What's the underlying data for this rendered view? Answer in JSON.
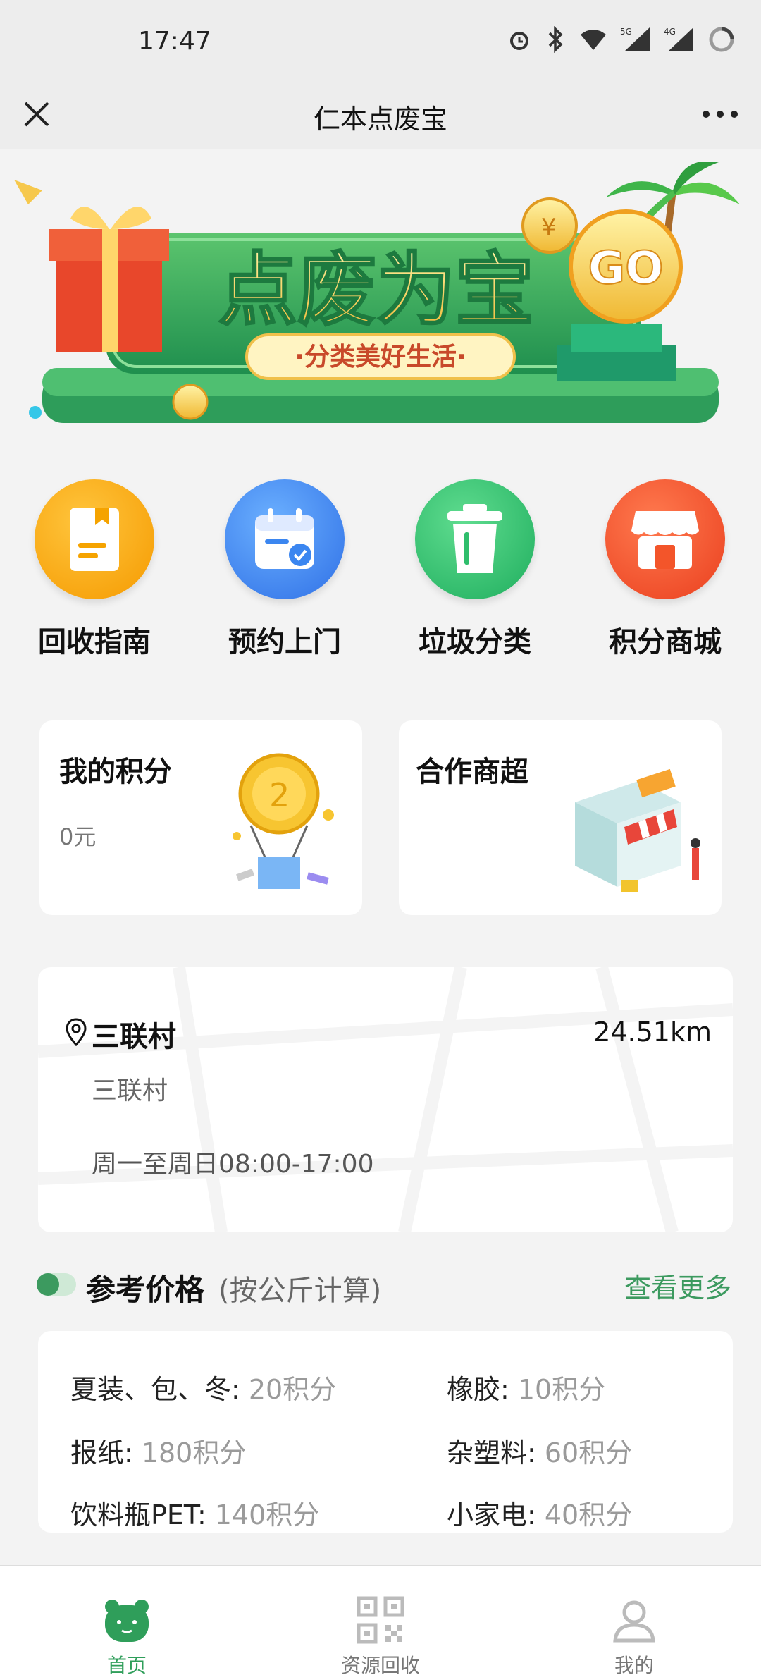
{
  "status_bar": {
    "time": "17:47",
    "icons": [
      "alarm-icon",
      "bluetooth-icon",
      "wifi-icon",
      "signal-5g-icon",
      "signal-4g-icon",
      "loading-icon"
    ]
  },
  "title_bar": {
    "title": "仁本点废宝"
  },
  "banner": {
    "headline": "点废为宝",
    "slogan": "·分类美好生活·",
    "go_text": "GO"
  },
  "menu": [
    {
      "label": "回收指南",
      "icon": "guide-icon",
      "color": "#f7a800"
    },
    {
      "label": "预约上门",
      "icon": "calendar-icon",
      "color": "#3b86f0"
    },
    {
      "label": "垃圾分类",
      "icon": "trash-icon",
      "color": "#2fbe6c"
    },
    {
      "label": "积分商城",
      "icon": "shop-icon",
      "color": "#f3552a"
    }
  ],
  "cards": {
    "points_title": "我的积分",
    "points_value": "0元",
    "partner_title": "合作商超"
  },
  "location": {
    "name": "三联村",
    "distance": "24.51km",
    "address": "三联村",
    "hours": "周一至周日08:00-17:00"
  },
  "price": {
    "title": "参考价格",
    "subtitle": "(按公斤计算)",
    "more": "查看更多",
    "items": [
      {
        "name": "夏装、包、冬:",
        "value": "20积分"
      },
      {
        "name": "橡胶:",
        "value": "10积分"
      },
      {
        "name": "报纸:",
        "value": "180积分"
      },
      {
        "name": "杂塑料:",
        "value": "60积分"
      },
      {
        "name": "饮料瓶PET:",
        "value": "140积分"
      },
      {
        "name": "小家电:",
        "value": "40积分"
      }
    ]
  },
  "bottom_nav": [
    {
      "label": "首页",
      "icon": "bear-home-icon",
      "active": true
    },
    {
      "label": "资源回收",
      "icon": "qr-code-icon",
      "active": false
    },
    {
      "label": "我的",
      "icon": "profile-icon",
      "active": false
    }
  ],
  "colors": {
    "accent": "#3c9a5f",
    "background": "#f3f3f3"
  }
}
